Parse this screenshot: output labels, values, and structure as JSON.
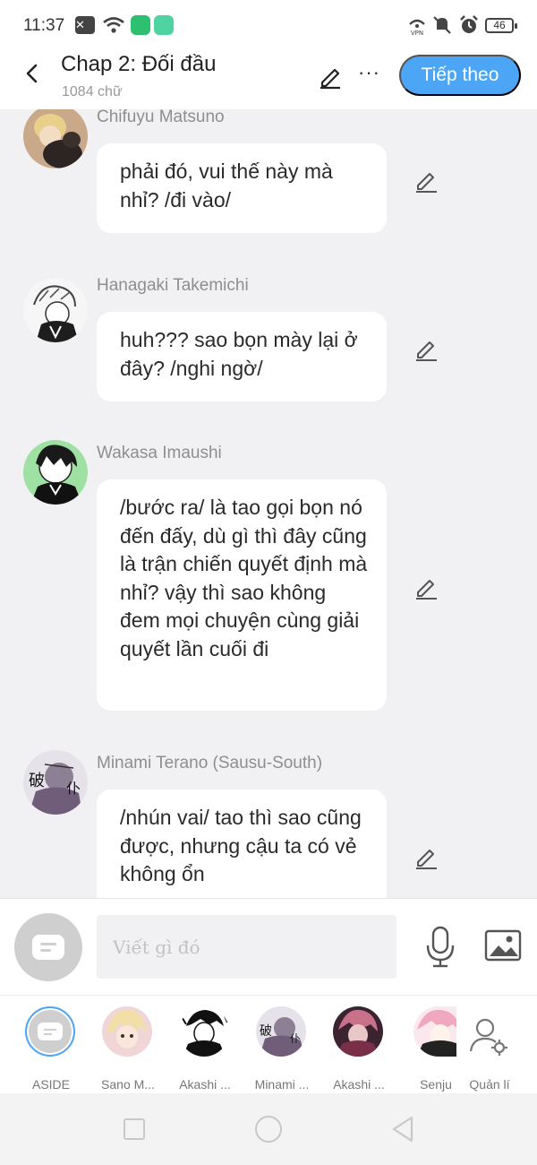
{
  "status_bar": {
    "time": "11:37",
    "battery": "46",
    "icons": [
      "close-notification-icon",
      "wifi-icon",
      "key-icon",
      "app-icon",
      "vpn-icon",
      "mute-icon",
      "alarm-icon",
      "battery-icon"
    ]
  },
  "header": {
    "title": "Chap 2: Đối đầu",
    "word_count": "1084 chữ",
    "more_label": "···",
    "next_label": "Tiếp theo",
    "accent_color": "#4da6f5"
  },
  "messages": [
    {
      "sender": "Chifuyu Matsuno",
      "text": "phải đó, vui thế này mà nhỉ? /đi vào/"
    },
    {
      "sender": "Hanagaki Takemichi",
      "text": "huh??? sao bọn mày lại ở đây? /nghi ngờ/"
    },
    {
      "sender": "Wakasa Imaushi",
      "text": "/bước ra/ là tao gọi bọn nó đến đấy, dù gì thì đây cũng là trận chiến quyết định mà nhỉ? vậy thì sao không đem mọi chuyện cùng giải quyết lần cuối đi"
    },
    {
      "sender": "Minami Terano (Sausu-South)",
      "text": "/nhún vai/ tao thì sao cũng được, nhưng cậu ta có vẻ không ổn"
    }
  ],
  "composer": {
    "placeholder": "Viết gì đó"
  },
  "characters": [
    {
      "label": "ASIDE"
    },
    {
      "label": "Sano M..."
    },
    {
      "label": "Akashi ..."
    },
    {
      "label": "Minami ..."
    },
    {
      "label": "Akashi ..."
    },
    {
      "label": "Senju"
    },
    {
      "label": "Quản lí"
    }
  ]
}
